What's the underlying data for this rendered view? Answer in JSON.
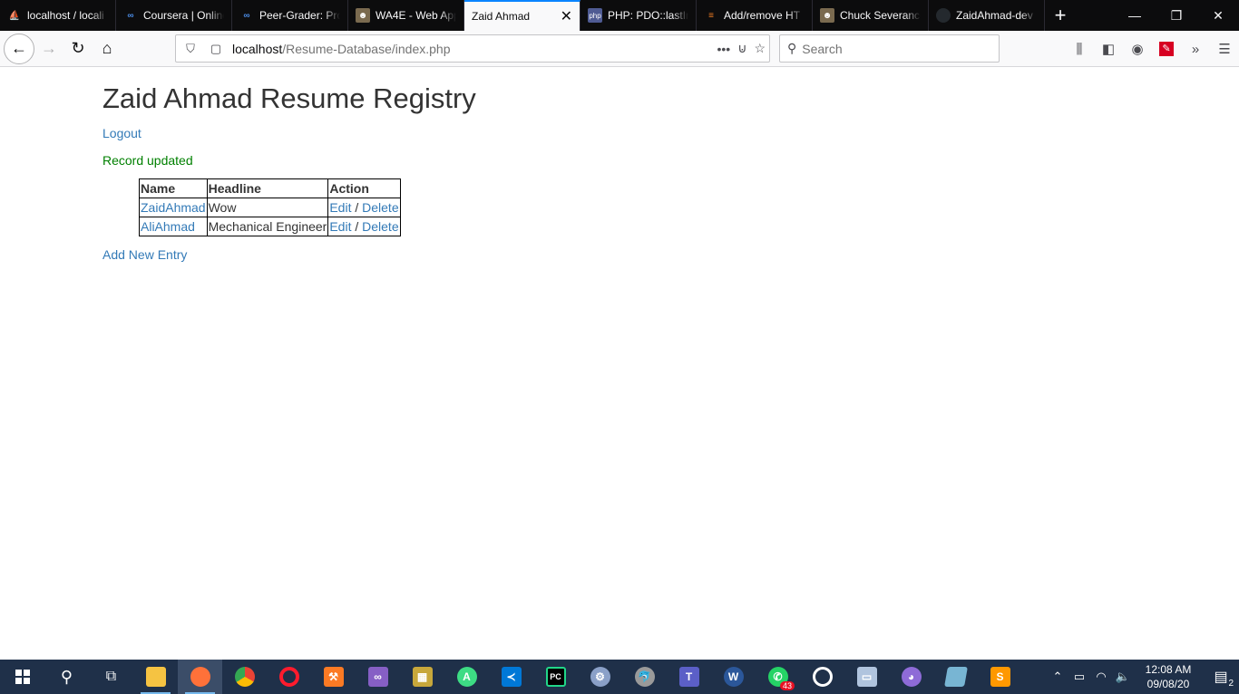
{
  "browser": {
    "tabs": [
      {
        "title": "localhost / locali",
        "icon": "phpmyadmin-icon",
        "color": "#f89c0e"
      },
      {
        "title": "Coursera | Online",
        "icon": "coursera-icon",
        "color": "#2a73cc"
      },
      {
        "title": "Peer-Grader: Pro",
        "icon": "coursera-icon",
        "color": "#2a73cc"
      },
      {
        "title": "WA4E - Web App",
        "icon": "wa4e-icon",
        "color": "#7a6a4f"
      },
      {
        "title": "Zaid Ahmad",
        "icon": "",
        "color": "",
        "active": true
      },
      {
        "title": "PHP: PDO::lastIn",
        "icon": "php-icon",
        "color": "#4f5b93"
      },
      {
        "title": "Add/remove HT",
        "icon": "stackoverflow-icon",
        "color": "#f48024"
      },
      {
        "title": "Chuck Severance",
        "icon": "wa4e-icon",
        "color": "#7a6a4f"
      },
      {
        "title": "ZaidAhmad-dev",
        "icon": "github-icon",
        "color": "#24292e"
      }
    ],
    "url_host": "localhost",
    "url_path": "/Resume-Database/index.php",
    "search_placeholder": "Search"
  },
  "page": {
    "title": "Zaid Ahmad Resume Registry",
    "logout": "Logout",
    "message": "Record updated",
    "table": {
      "headers": [
        "Name",
        "Headline",
        "Action"
      ],
      "rows": [
        {
          "name": "ZaidAhmad",
          "headline": "Wow",
          "edit": "Edit",
          "sep": " / ",
          "delete": "Delete"
        },
        {
          "name": "AliAhmad",
          "headline": "Mechanical Engineer",
          "edit": "Edit",
          "sep": " / ",
          "delete": "Delete"
        }
      ]
    },
    "add_new": "Add New Entry"
  },
  "taskbar": {
    "apps": [
      {
        "name": "file-explorer-icon",
        "color": "#f5c342"
      },
      {
        "name": "firefox-icon",
        "color": "#ff7139",
        "active": true
      },
      {
        "name": "chrome-icon",
        "color": "#4caf50"
      },
      {
        "name": "opera-icon",
        "color": "#ff1b2d"
      },
      {
        "name": "xampp-icon",
        "color": "#fb7a24"
      },
      {
        "name": "visual-studio-icon",
        "color": "#865fc5"
      },
      {
        "name": "app-installer-icon",
        "color": "#c7a73b"
      },
      {
        "name": "android-studio-icon",
        "color": "#3ddc84"
      },
      {
        "name": "vscode-icon",
        "color": "#0078d7"
      },
      {
        "name": "pycharm-icon",
        "color": "#21d789"
      },
      {
        "name": "settings-app-icon",
        "color": "#8aa0c8"
      },
      {
        "name": "mysql-workbench-icon",
        "color": "#9a9a9a"
      },
      {
        "name": "teams-icon",
        "color": "#5b5fc7"
      },
      {
        "name": "word-icon",
        "color": "#2b579a"
      },
      {
        "name": "whatsapp-icon",
        "color": "#25d366",
        "badge": "43"
      },
      {
        "name": "obs-icon",
        "color": "#ffffff"
      },
      {
        "name": "remote-desktop-icon",
        "color": "#b0c4de"
      },
      {
        "name": "github-desktop-icon",
        "color": "#8e6bd7"
      },
      {
        "name": "notepad-icon",
        "color": "#78b5d3"
      },
      {
        "name": "sublime-text-icon",
        "color": "#ff9800"
      }
    ],
    "time": "12:08 AM",
    "date": "09/08/20",
    "notifications": "2"
  }
}
